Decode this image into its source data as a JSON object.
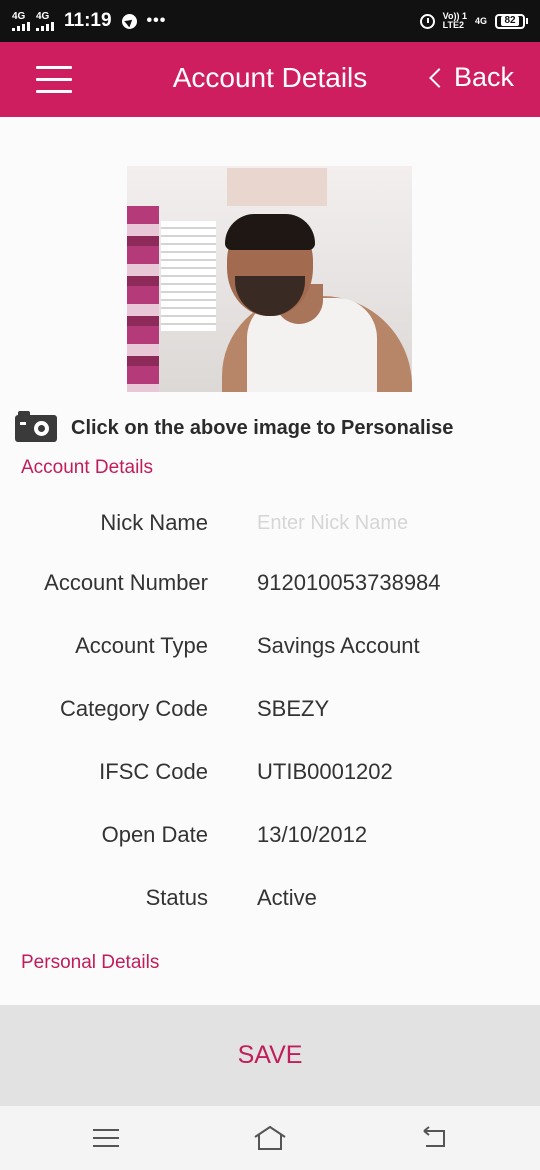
{
  "status_bar": {
    "network_1": "4G",
    "network_2": "4G",
    "time": "11:19",
    "more": "•••",
    "volte_line1": "Vo)) 1",
    "volte_line2": "LTE2",
    "network_right": "4G",
    "battery": "82"
  },
  "app_bar": {
    "title": "Account Details",
    "back_label": "Back",
    "background_color": "#cf1e5f"
  },
  "profile": {
    "photo_icon": "profile-photo",
    "personalise_text": "Click on the above image to Personalise"
  },
  "account_section": {
    "title": "Account Details",
    "fields": [
      {
        "label": "Nick Name",
        "value": "",
        "placeholder": "Enter Nick Name"
      },
      {
        "label": "Account Number",
        "value": "912010053738984"
      },
      {
        "label": "Account Type",
        "value": "Savings Account"
      },
      {
        "label": "Category Code",
        "value": "SBEZY"
      },
      {
        "label": "IFSC Code",
        "value": "UTIB0001202"
      },
      {
        "label": "Open Date",
        "value": "13/10/2012"
      },
      {
        "label": "Status",
        "value": "Active"
      }
    ]
  },
  "personal_section": {
    "title": "Personal Details"
  },
  "save": {
    "label": "SAVE",
    "accent_color": "#c21d5b"
  },
  "nav_bar": {
    "icons": [
      "menu-icon",
      "home-icon",
      "back-icon"
    ]
  }
}
